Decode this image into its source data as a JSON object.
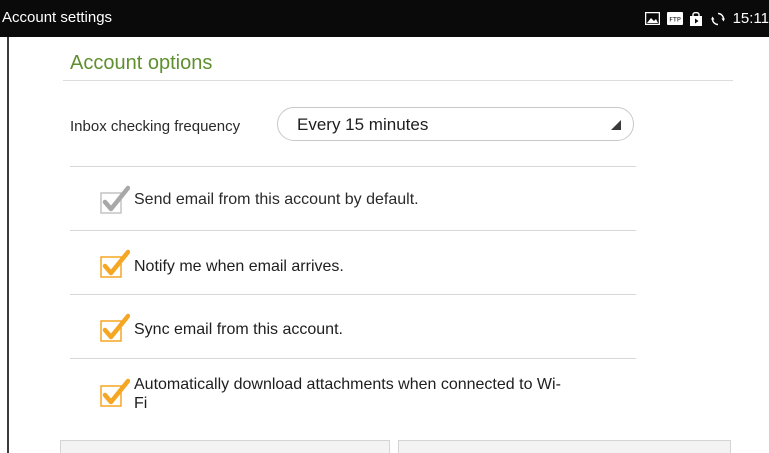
{
  "statusbar": {
    "title": "Account settings",
    "time": "15:11",
    "icons": [
      "image-icon",
      "ftp-icon",
      "shopping-bag-icon",
      "sync-icon"
    ],
    "ftp_text": "FTP"
  },
  "section": {
    "title": "Account options"
  },
  "frequency": {
    "label": "Inbox checking frequency",
    "value": "Every 15 minutes"
  },
  "checkboxes": [
    {
      "label": "Send email from this account by default.",
      "checked": true,
      "enabled": false
    },
    {
      "label": "Notify me when email arrives.",
      "checked": true,
      "enabled": true
    },
    {
      "label": "Sync email from this account.",
      "checked": true,
      "enabled": true
    },
    {
      "label": "Automatically download attachments when connected to Wi-",
      "label_line2": "Fi",
      "checked": true,
      "enabled": true
    }
  ],
  "colors": {
    "accent_green": "#5f8f2f",
    "checkbox_orange": "#f5a623",
    "checkbox_disabled": "#a8a8a8",
    "statusbar_bg": "#0a0a0a"
  }
}
